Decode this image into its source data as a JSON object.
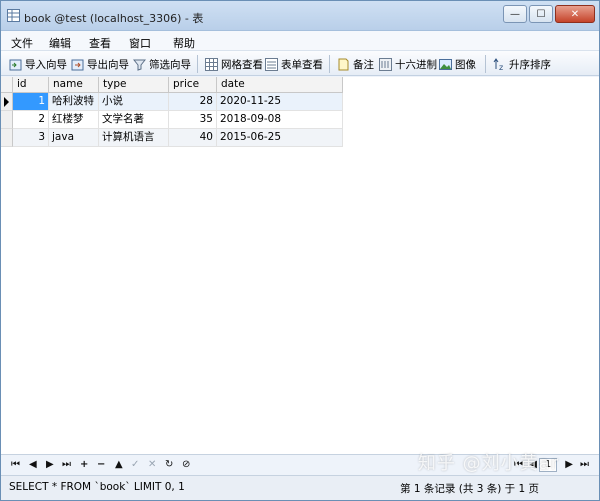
{
  "window": {
    "title": "book @test (localhost_3306) - 表",
    "minimize": "—",
    "maximize": "☐",
    "close": "✕"
  },
  "menu": [
    "文件",
    "编辑",
    "查看",
    "窗口",
    "帮助"
  ],
  "toolbar": {
    "import": "导入向导",
    "export": "导出向导",
    "filter": "筛选向导",
    "grid_view": "网格查看",
    "form_view": "表单查看",
    "memo": "备注",
    "hex": "十六进制",
    "image": "图像",
    "sort_asc": "升序排序"
  },
  "table": {
    "columns": [
      "id",
      "name",
      "type",
      "price",
      "date"
    ],
    "rows": [
      [
        "1",
        "哈利波特",
        "小说",
        "28",
        "2020-11-25"
      ],
      [
        "2",
        "红楼梦",
        "文学名著",
        "35",
        "2018-09-08"
      ],
      [
        "3",
        "java",
        "计算机语言",
        "40",
        "2015-06-25"
      ]
    ]
  },
  "navbar": {
    "first": "⏮",
    "prev": "◀",
    "next": "▶",
    "last": "⏭",
    "add": "+",
    "remove": "−",
    "up": "▲",
    "check": "✓",
    "cancel": "✕",
    "refresh": "↻",
    "stop": "⊘",
    "page": "1"
  },
  "status": {
    "sql": "SELECT * FROM `book` LIMIT 0, 1",
    "records": "第 1 条记录 (共 3 条) 于 1 页"
  },
  "watermark": "知乎 @刘小黄ar"
}
